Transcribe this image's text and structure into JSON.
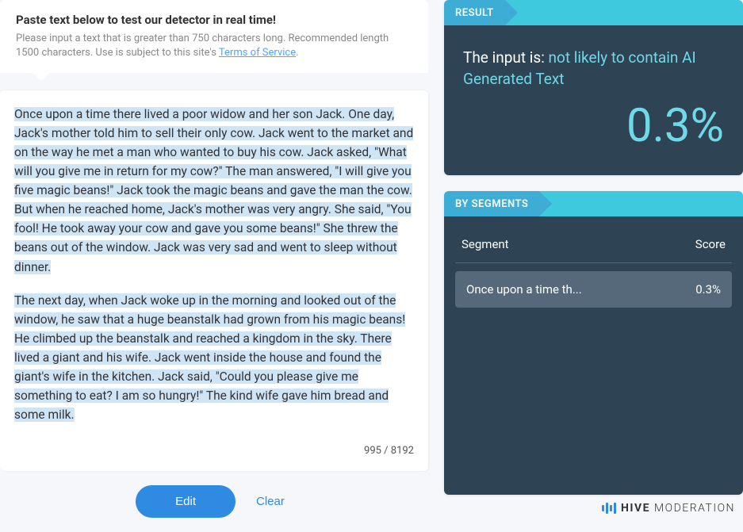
{
  "header": {
    "title": "Paste text below to test our detector in real time!",
    "description_prefix": "Please input a text that is greater than 750 characters long. Recommended length 1500 characters. Use is subject to this site's ",
    "tos_label": "Terms of Service",
    "description_suffix": "."
  },
  "input": {
    "paragraph1": "Once upon a time there lived a poor widow and her son Jack. One day, Jack's mother told him to sell their only cow. Jack went to the market and on the way he met a man who wanted to buy his cow. Jack asked, \"What will you give me in return for my cow?\" The man answered, \"I will give you five magic beans!\" Jack took the magic beans and gave the man the cow. But when he reached home, Jack's mother was very angry. She said, \"You fool! He took away your cow and gave you some beans!\" She threw the beans out of the window. Jack was very sad and went to sleep without dinner.",
    "paragraph2": "The next day, when Jack woke up in the morning and looked out of the window, he saw that a huge beanstalk had grown from his magic beans! He climbed up the beanstalk and reached a kingdom in the sky. There lived a giant and his wife. Jack went inside the house and found the giant's wife in the kitchen. Jack said, \"Could you please give me something to eat? I am so hungry!\" The kind wife gave him bread and some milk.",
    "char_count": "995",
    "char_separator": " / ",
    "char_max": "8192"
  },
  "buttons": {
    "edit": "Edit",
    "clear": "Clear"
  },
  "result": {
    "header_label": "RESULT",
    "prefix": "The input is: ",
    "verdict": "not likely to contain AI Generated Text",
    "percentage": "0.3%"
  },
  "segments": {
    "header_label": "BY SEGMENTS",
    "col_segment": "Segment",
    "col_score": "Score",
    "rows": [
      {
        "text": "Once upon a time th...",
        "score": "0.3%"
      }
    ]
  },
  "brand": {
    "bold": "HIVE",
    "light": "MODERATION"
  }
}
